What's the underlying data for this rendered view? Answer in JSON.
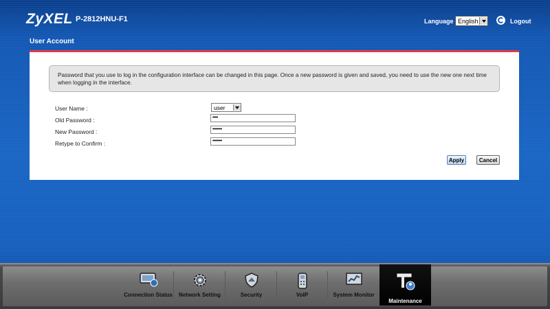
{
  "header": {
    "brand": "ZyXEL",
    "model": "P-2812HNU-F1",
    "language_label": "Language :",
    "language_value": "English",
    "logout_label": "Logout"
  },
  "page": {
    "title": "User Account",
    "notice": "Password that you use to log in the configuration interface can be changed in this page. Once a new password is given and saved, you need to use the new one next time when logging in the interface."
  },
  "form": {
    "username_label": "User Name :",
    "username_value": "user",
    "old_password_label": "Old Password :",
    "old_password_value": "••••",
    "new_password_label": "New Password :",
    "new_password_value": "•••••••",
    "retype_label": "Retype to Confirm :",
    "retype_value": "•••••••",
    "apply_label": "Apply",
    "cancel_label": "Cancel"
  },
  "nav": {
    "tabs": [
      {
        "label": "Connection Status",
        "icon": "monitor-icon"
      },
      {
        "label": "Network Setting",
        "icon": "gear-icon"
      },
      {
        "label": "Security",
        "icon": "shield-icon"
      },
      {
        "label": "VoIP",
        "icon": "phone-icon"
      },
      {
        "label": "System Monitor",
        "icon": "chart-icon"
      },
      {
        "label": "Maintenance",
        "icon": "tools-icon",
        "active": true
      }
    ]
  },
  "colors": {
    "background": "#1a66c4",
    "accent_line": "#e03a48",
    "dock": "#6e6e6e"
  }
}
